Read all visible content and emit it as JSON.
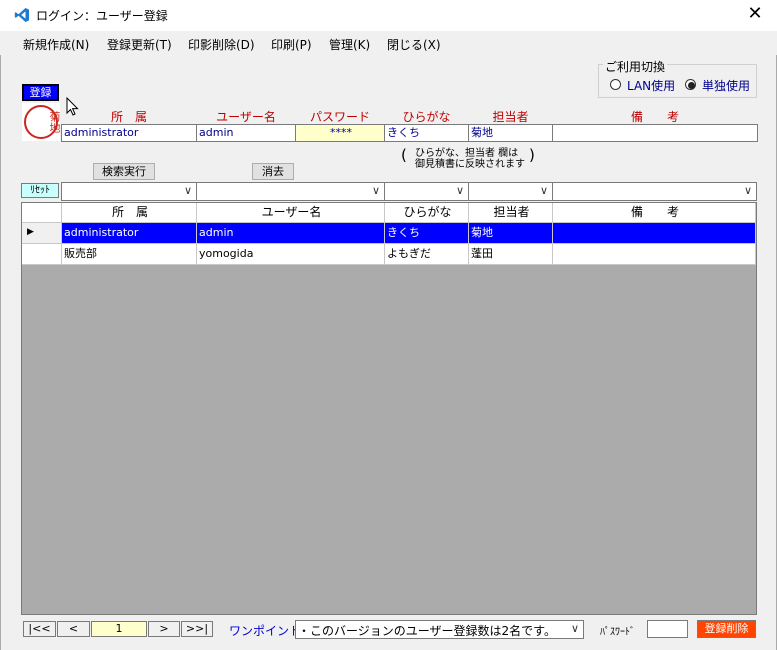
{
  "window": {
    "title": "ログイン：ユーザー登録",
    "close": "✕"
  },
  "menu": [
    "新規作成(N)",
    "登録更新(T)",
    "印影削除(D)",
    "印刷(P)",
    "管理(K)",
    "閉じる(X)"
  ],
  "mode": {
    "group_label": "ご利用切換",
    "lan": "LAN使用",
    "standalone": "単独使用"
  },
  "register_button": "登録",
  "seal": {
    "text": "菊地"
  },
  "form": {
    "headers": {
      "department": "所　属",
      "username": "ユーザー名",
      "password": "パスワード",
      "hiragana": "ひらがな",
      "person": "担当者",
      "note": "備　　考"
    },
    "values": {
      "department": "administrator",
      "username": "admin",
      "password": "****",
      "hiragana": "きくち",
      "person": "菊地",
      "note": ""
    },
    "hint_line1": "ひらがな、担当者 欄は",
    "hint_line2": "御見積書に反映されます"
  },
  "search_button": "検索実行",
  "clear_button": "消去",
  "reset_button": "ﾘｾｯﾄ",
  "grid": {
    "headers": [
      "所　属",
      "ユーザー名",
      "ひらがな",
      "担当者",
      "備　　考"
    ],
    "rows": [
      {
        "department": "administrator",
        "username": "admin",
        "hiragana": "きくち",
        "person": "菊地",
        "note": ""
      },
      {
        "department": "販売部",
        "username": "yomogida",
        "hiragana": "よもぎだ",
        "person": "蓬田",
        "note": ""
      }
    ]
  },
  "footer": {
    "first": "|<<",
    "prev": "<",
    "page": "1",
    "next": ">",
    "last": ">>|",
    "tip_label": "ワンポイント:",
    "tip_text": "・このバージョンのユーザー登録数は2名です。",
    "password_label": "ﾊﾟｽﾜｰﾄﾞ",
    "delete_button": "登録削除"
  },
  "colors": {
    "accent": "#0000ff",
    "label_red": "#c00000",
    "password_bg": "#ffffcc",
    "delete_bg": "#ff4500"
  }
}
